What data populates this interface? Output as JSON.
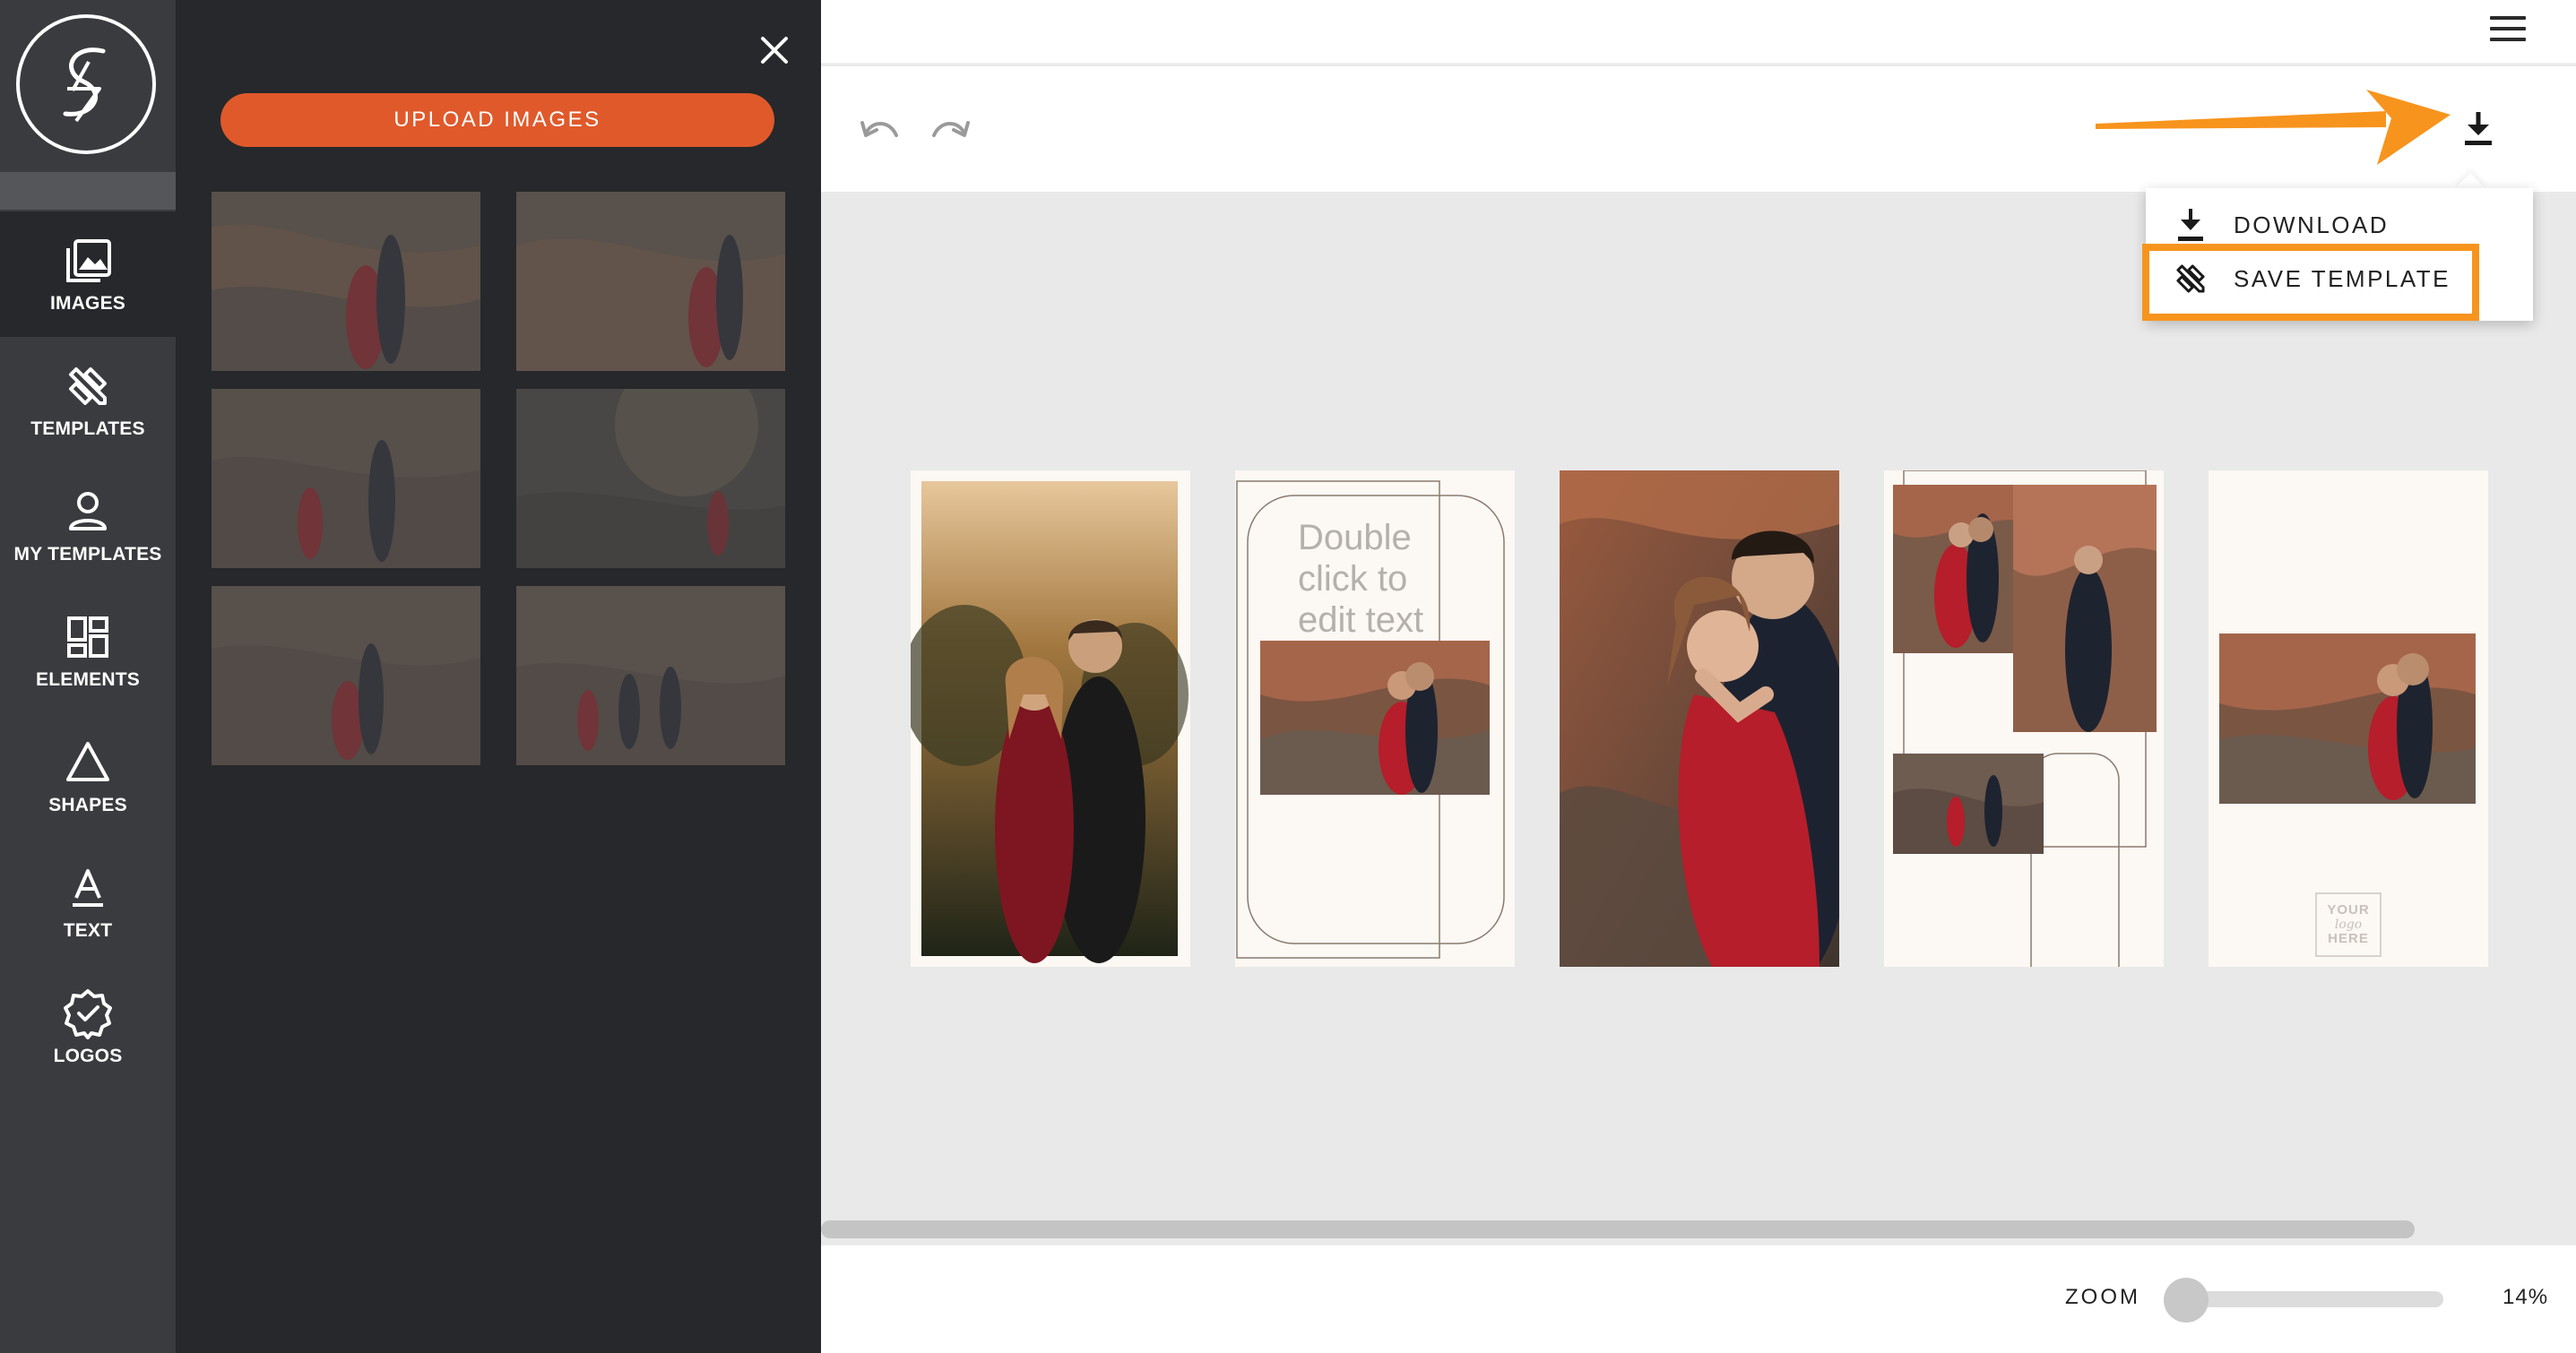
{
  "sidebar": {
    "items": [
      {
        "label": "IMAGES",
        "icon": "image-icon"
      },
      {
        "label": "TEMPLATES",
        "icon": "templates-icon"
      },
      {
        "label": "MY TEMPLATES",
        "icon": "user-icon"
      },
      {
        "label": "ELEMENTS",
        "icon": "elements-icon"
      },
      {
        "label": "SHAPES",
        "icon": "triangle-icon"
      },
      {
        "label": "TEXT",
        "icon": "text-icon"
      },
      {
        "label": "LOGOS",
        "icon": "badge-check-icon"
      }
    ],
    "active": "IMAGES"
  },
  "images_panel": {
    "upload_label": "UPLOAD IMAGES",
    "thumbnail_count": 6
  },
  "canvas": {
    "placeholder_text": "Double click to edit text",
    "logo_placeholder": {
      "line1": "YOUR",
      "line2": "logo",
      "line3": "HERE"
    },
    "page_count": 5
  },
  "download_menu": {
    "items": [
      {
        "label": "DOWNLOAD",
        "icon": "download-icon"
      },
      {
        "label": "SAVE TEMPLATE",
        "icon": "templates-icon"
      }
    ],
    "highlighted": "SAVE TEMPLATE"
  },
  "zoom": {
    "label": "ZOOM",
    "value": "14%",
    "level": 0.14
  },
  "colors": {
    "accent": "#e0592b",
    "highlight": "#f7941d",
    "rail": "#3a3b3e",
    "panel": "#26282b",
    "canvas": "#e9e9e9",
    "page": "#fcf8f3",
    "dress_red": "#b51e2a"
  }
}
